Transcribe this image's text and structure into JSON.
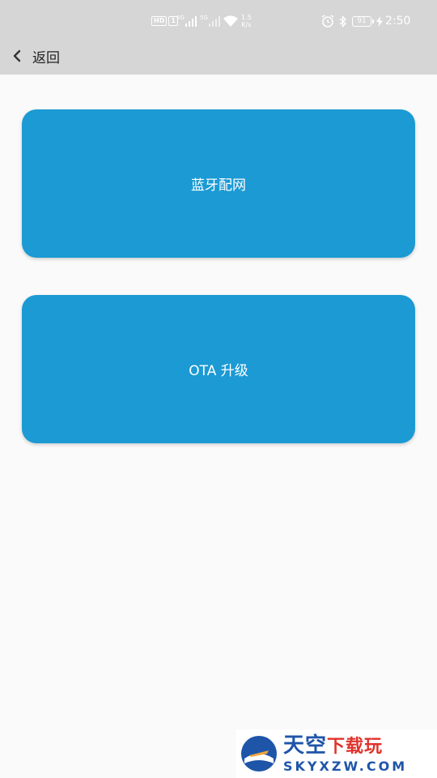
{
  "status_bar": {
    "hd": "HD",
    "hd_num": "1",
    "sim1_label": "5G",
    "sim2_label": "5G",
    "speed_value": "1.5",
    "speed_unit": "K/s",
    "battery": "91",
    "time": "2:50",
    "icons": [
      "signal-icon",
      "wifi-icon",
      "alarm-icon",
      "bluetooth-icon",
      "battery-icon",
      "charging-icon"
    ]
  },
  "nav": {
    "back_label": "返回",
    "back_icon": "chevron-left-icon"
  },
  "buttons": {
    "bluetooth_network": "蓝牙配网",
    "ota_upgrade": "OTA 升级"
  },
  "colors": {
    "topbar": "#d6d6d6",
    "card": "#1b9ad4",
    "background": "#fafafa"
  },
  "watermark": {
    "cn_main": "天空",
    "cn_sub": "下载玩",
    "en": "SKYXZW.COM"
  }
}
